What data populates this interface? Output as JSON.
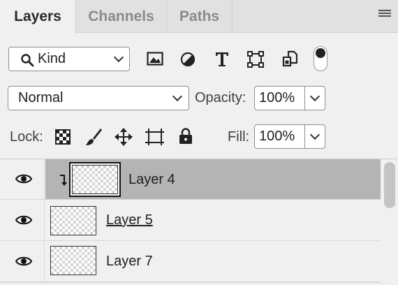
{
  "tabs": [
    {
      "label": "Layers",
      "active": true
    },
    {
      "label": "Channels",
      "active": false
    },
    {
      "label": "Paths",
      "active": false
    }
  ],
  "filter": {
    "kind_label": "Kind",
    "icons": [
      "image-filter-icon",
      "adjustment-filter-icon",
      "type-filter-icon",
      "shape-filter-icon",
      "smart-object-filter-icon",
      "filter-toggle-switch"
    ]
  },
  "blend": {
    "mode": "Normal",
    "opacity_label": "Opacity:",
    "opacity_value": "100%"
  },
  "lock": {
    "label": "Lock:",
    "icons": [
      "lock-transparent-pixels-icon",
      "lock-image-pixels-icon",
      "lock-position-icon",
      "lock-artboard-icon",
      "lock-all-icon"
    ],
    "fill_label": "Fill:",
    "fill_value": "100%"
  },
  "layers": [
    {
      "name": "Layer 4",
      "selected": true,
      "clipped": true,
      "underlined": false
    },
    {
      "name": "Layer 5",
      "selected": false,
      "clipped": false,
      "underlined": true
    },
    {
      "name": "Layer 7",
      "selected": false,
      "clipped": false,
      "underlined": false
    }
  ],
  "colors": {
    "selected_row": "#b4b4b4",
    "panel_bg": "#f0f0f0"
  }
}
